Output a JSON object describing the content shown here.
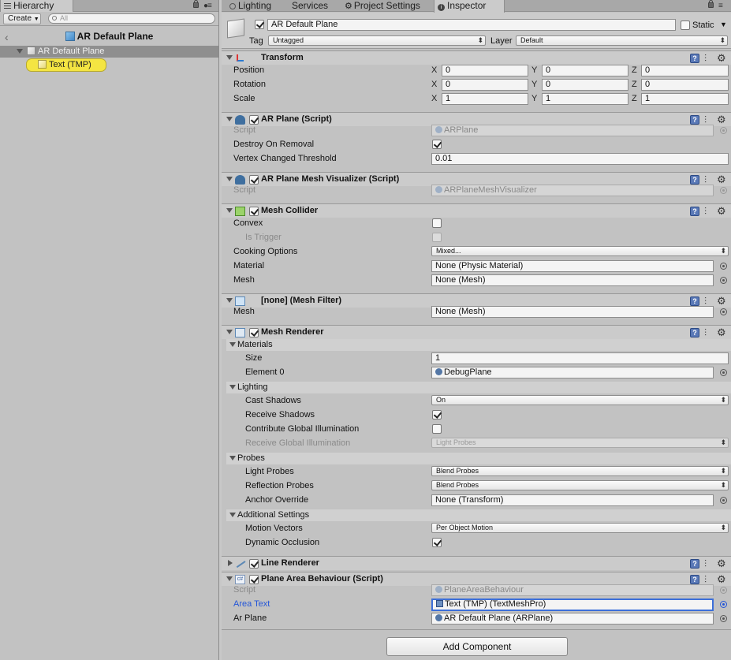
{
  "hierarchy": {
    "tab_label": "Hierarchy",
    "create_label": "Create",
    "search_placeholder": "All",
    "scene_title": "AR Default Plane",
    "items": [
      {
        "label": "AR Default Plane"
      },
      {
        "label": "Text (TMP)"
      }
    ]
  },
  "tabs": [
    {
      "label": "Lighting"
    },
    {
      "label": "Services"
    },
    {
      "label": "Project Settings"
    },
    {
      "label": "Inspector"
    }
  ],
  "object": {
    "name": "AR Default Plane",
    "static_label": "Static",
    "tag_label": "Tag",
    "tag_value": "Untagged",
    "layer_label": "Layer",
    "layer_value": "Default"
  },
  "transform": {
    "title": "Transform",
    "rows": [
      {
        "label": "Position",
        "x": "0",
        "y": "0",
        "z": "0"
      },
      {
        "label": "Rotation",
        "x": "0",
        "y": "0",
        "z": "0"
      },
      {
        "label": "Scale",
        "x": "1",
        "y": "1",
        "z": "1"
      }
    ],
    "axes": {
      "x": "X",
      "y": "Y",
      "z": "Z"
    }
  },
  "ar_plane": {
    "title": "AR Plane (Script)",
    "script_label": "Script",
    "script_value": "ARPlane",
    "destroy_label": "Destroy On Removal",
    "vertex_label": "Vertex Changed Threshold",
    "vertex_value": "0.01"
  },
  "ar_mesh_vis": {
    "title": "AR Plane Mesh Visualizer (Script)",
    "script_label": "Script",
    "script_value": "ARPlaneMeshVisualizer"
  },
  "mesh_collider": {
    "title": "Mesh Collider",
    "convex_label": "Convex",
    "trigger_label": "Is Trigger",
    "cooking_label": "Cooking Options",
    "cooking_value": "Mixed...",
    "material_label": "Material",
    "material_value": "None (Physic Material)",
    "mesh_label": "Mesh",
    "mesh_value": "None (Mesh)"
  },
  "mesh_filter": {
    "title": "[none] (Mesh Filter)",
    "mesh_label": "Mesh",
    "mesh_value": "None (Mesh)"
  },
  "mesh_renderer": {
    "title": "Mesh Renderer",
    "materials_label": "Materials",
    "size_label": "Size",
    "size_value": "1",
    "element_label": "Element 0",
    "element_value": "DebugPlane",
    "lighting_label": "Lighting",
    "cast_label": "Cast Shadows",
    "cast_value": "On",
    "receive_label": "Receive Shadows",
    "contribute_label": "Contribute Global Illumination",
    "receive_gi_label": "Receive Global Illumination",
    "receive_gi_value": "Light Probes",
    "probes_label": "Probes",
    "light_probes_label": "Light Probes",
    "light_probes_value": "Blend Probes",
    "reflection_label": "Reflection Probes",
    "reflection_value": "Blend Probes",
    "anchor_label": "Anchor Override",
    "anchor_value": "None (Transform)",
    "additional_label": "Additional Settings",
    "motion_label": "Motion Vectors",
    "motion_value": "Per Object Motion",
    "occlusion_label": "Dynamic Occlusion"
  },
  "line_renderer": {
    "title": "Line Renderer"
  },
  "plane_area": {
    "title": "Plane Area Behaviour (Script)",
    "script_label": "Script",
    "script_value": "PlaneAreaBehaviour",
    "area_label": "Area Text",
    "area_value": "Text (TMP) (TextMeshPro)",
    "arplane_label": "Ar Plane",
    "arplane_value": "AR Default Plane (ARPlane)"
  },
  "add_component_label": "Add Component",
  "colors": {
    "selection_yellow": "#f4e542",
    "accent_blue": "#3c6fd9"
  }
}
